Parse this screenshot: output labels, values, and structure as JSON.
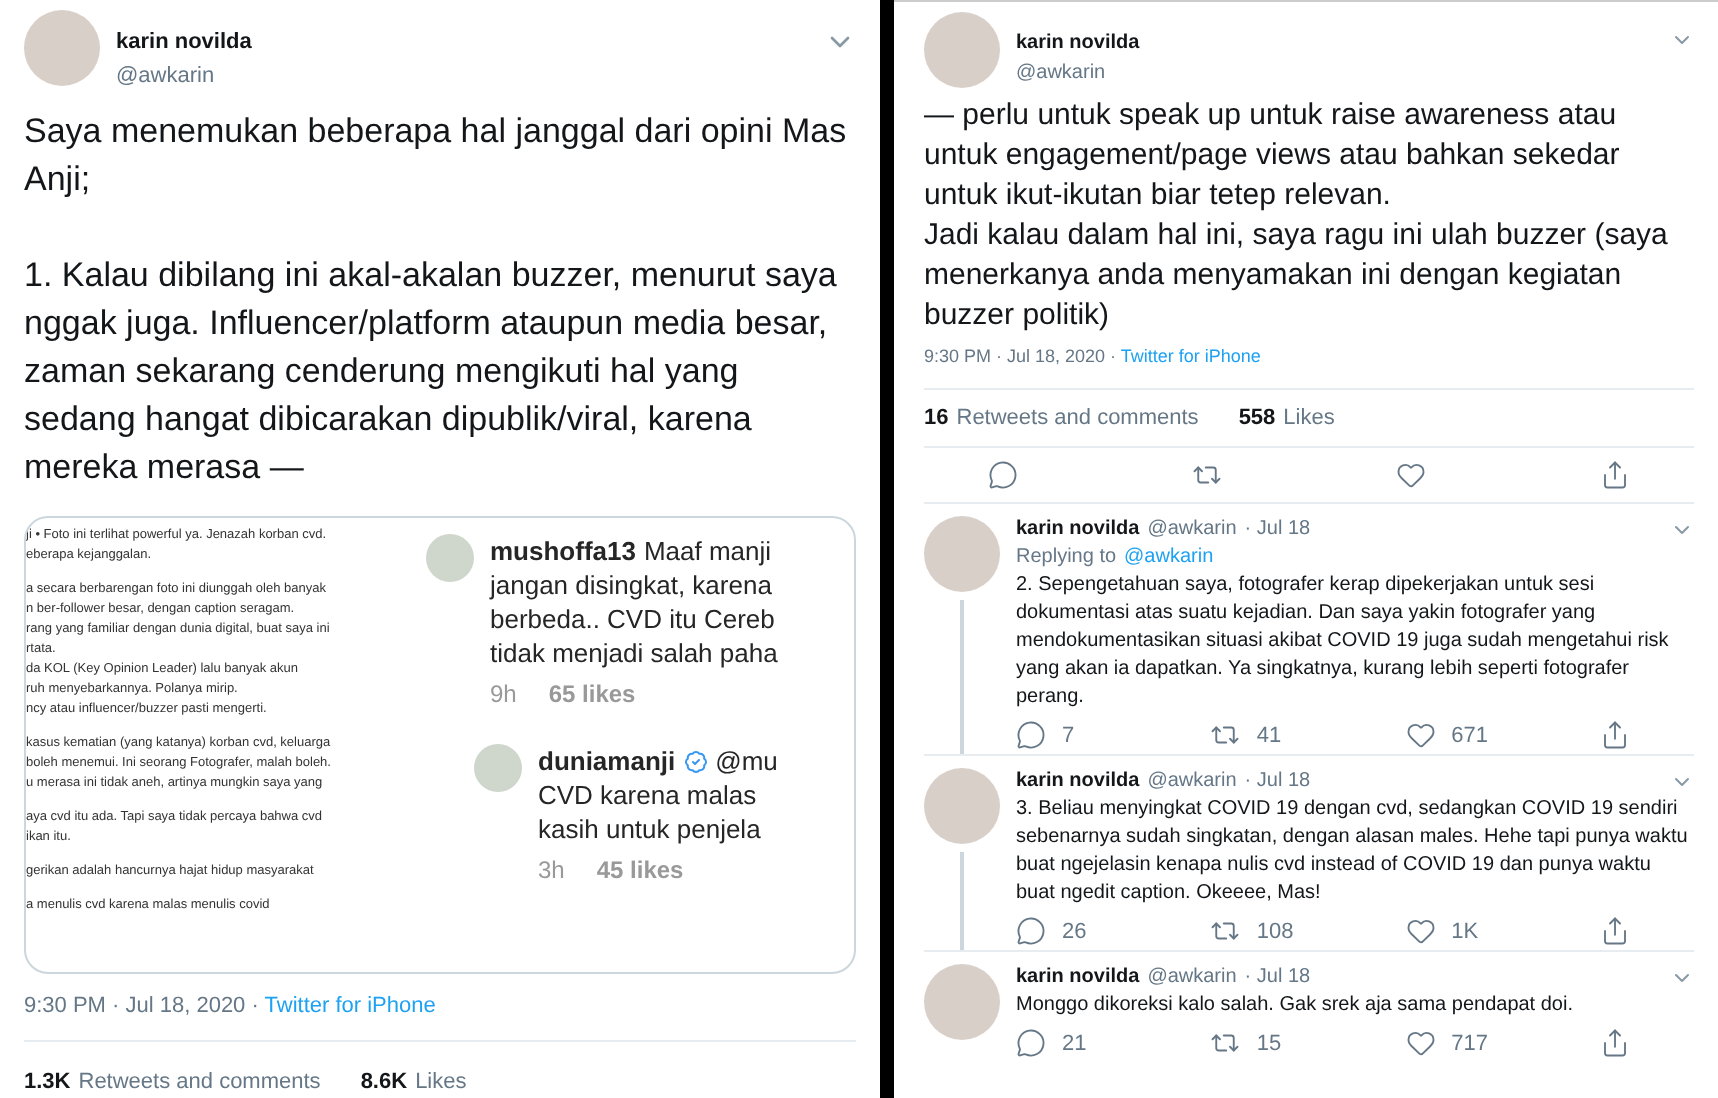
{
  "left_tweet": {
    "author": {
      "name": "karin novilda",
      "handle": "@awkarin"
    },
    "paragraphs": [
      "Saya menemukan beberapa hal janggal dari opini Mas Anji;",
      "1. Kalau dibilang ini akal-akalan buzzer, menurut saya nggak juga. Influencer/platform ataupun media besar, zaman sekarang cenderung mengikuti hal yang sedang hangat dibicarakan dipublik/viral, karena mereka merasa —"
    ],
    "embedded_screenshot": {
      "caption_paragraphs": [
        [
          "ji • Foto ini terlihat powerful ya. Jenazah korban cvd.",
          "eberapa kejanggalan."
        ],
        [
          "a secara berbarengan foto ini diunggah oleh banyak",
          "n ber-follower besar, dengan caption seragam.",
          "rang yang familiar dengan dunia digital, buat saya ini",
          "rtata.",
          "da KOL (Key Opinion Leader) lalu banyak akun",
          "ruh menyebarkannya. Polanya mirip.",
          "ncy atau influencer/buzzer pasti mengerti."
        ],
        [
          "kasus kematian (yang katanya) korban cvd, keluarga",
          "boleh menemui. Ini seorang Fotografer, malah boleh.",
          "u merasa ini tidak aneh, artinya mungkin saya yang"
        ],
        [
          "aya cvd itu ada. Tapi saya tidak percaya bahwa cvd",
          "ikan itu."
        ],
        [
          "gerikan adalah hancurnya hajat hidup masyarakat"
        ],
        [
          "a menulis cvd karena malas menulis covid"
        ]
      ],
      "comments": [
        {
          "user": "mushoffa13",
          "verified": false,
          "lines": [
            "Maaf manji",
            "jangan disingkat, karena",
            "berbeda.. CVD itu Cereb",
            "tidak menjadi salah paha"
          ],
          "age": "9h",
          "likes": "65 likes"
        },
        {
          "user": "duniamanji",
          "verified": true,
          "mention": "@mu",
          "lines": [
            "CVD karena malas",
            "kasih untuk penjela"
          ],
          "age": "3h",
          "likes": "45 likes"
        }
      ]
    },
    "timestamp": "9:30 PM · Jul 18, 2020 · ",
    "source": "Twitter for iPhone",
    "stats": [
      {
        "count": "1.3K",
        "label": "Retweets and comments"
      },
      {
        "count": "8.6K",
        "label": "Likes"
      }
    ]
  },
  "right_tweet": {
    "author": {
      "name": "karin novilda",
      "handle": "@awkarin"
    },
    "paragraphs": [
      "— perlu untuk speak up untuk raise awareness atau untuk engagement/page views atau bahkan sekedar untuk ikut-ikutan biar tetep relevan.",
      "Jadi kalau dalam hal ini, saya ragu ini ulah buzzer (saya menerkanya anda menyamakan ini dengan kegiatan buzzer politik)"
    ],
    "timestamp": "9:30 PM · Jul 18, 2020 · ",
    "source": "Twitter for iPhone",
    "stats": [
      {
        "count": "16",
        "label": "Retweets and comments"
      },
      {
        "count": "558",
        "label": "Likes"
      }
    ]
  },
  "replies": [
    {
      "name": "karin novilda",
      "handle": "@awkarin",
      "date": "· Jul 18",
      "replying_label": "Replying to",
      "replying_to": "@awkarin",
      "text": "2. Sepengetahuan saya, fotografer kerap dipekerjakan untuk sesi dokumentasi atas suatu kejadian. Dan saya yakin fotografer yang mendokumentasikan situasi akibat COVID 19 juga sudah mengetahui risk yang akan ia dapatkan. Ya singkatnya, kurang lebih seperti fotografer perang.",
      "replies": "7",
      "retweets": "41",
      "likes": "671",
      "thread_continues": true
    },
    {
      "name": "karin novilda",
      "handle": "@awkarin",
      "date": "· Jul 18",
      "text": "3. Beliau menyingkat COVID 19 dengan cvd, sedangkan COVID 19 sendiri sebenarnya sudah singkatan, dengan alasan males. Hehe tapi punya waktu buat ngejelasin kenapa nulis cvd instead of COVID 19 dan punya waktu buat ngedit caption. Okeeee, Mas!",
      "replies": "26",
      "retweets": "108",
      "likes": "1K",
      "thread_continues": true
    },
    {
      "name": "karin novilda",
      "handle": "@awkarin",
      "date": "· Jul 18",
      "text": "Monggo dikoreksi kalo salah. Gak srek aja sama pendapat doi.",
      "replies": "21",
      "retweets": "15",
      "likes": "717",
      "thread_continues": false
    }
  ]
}
